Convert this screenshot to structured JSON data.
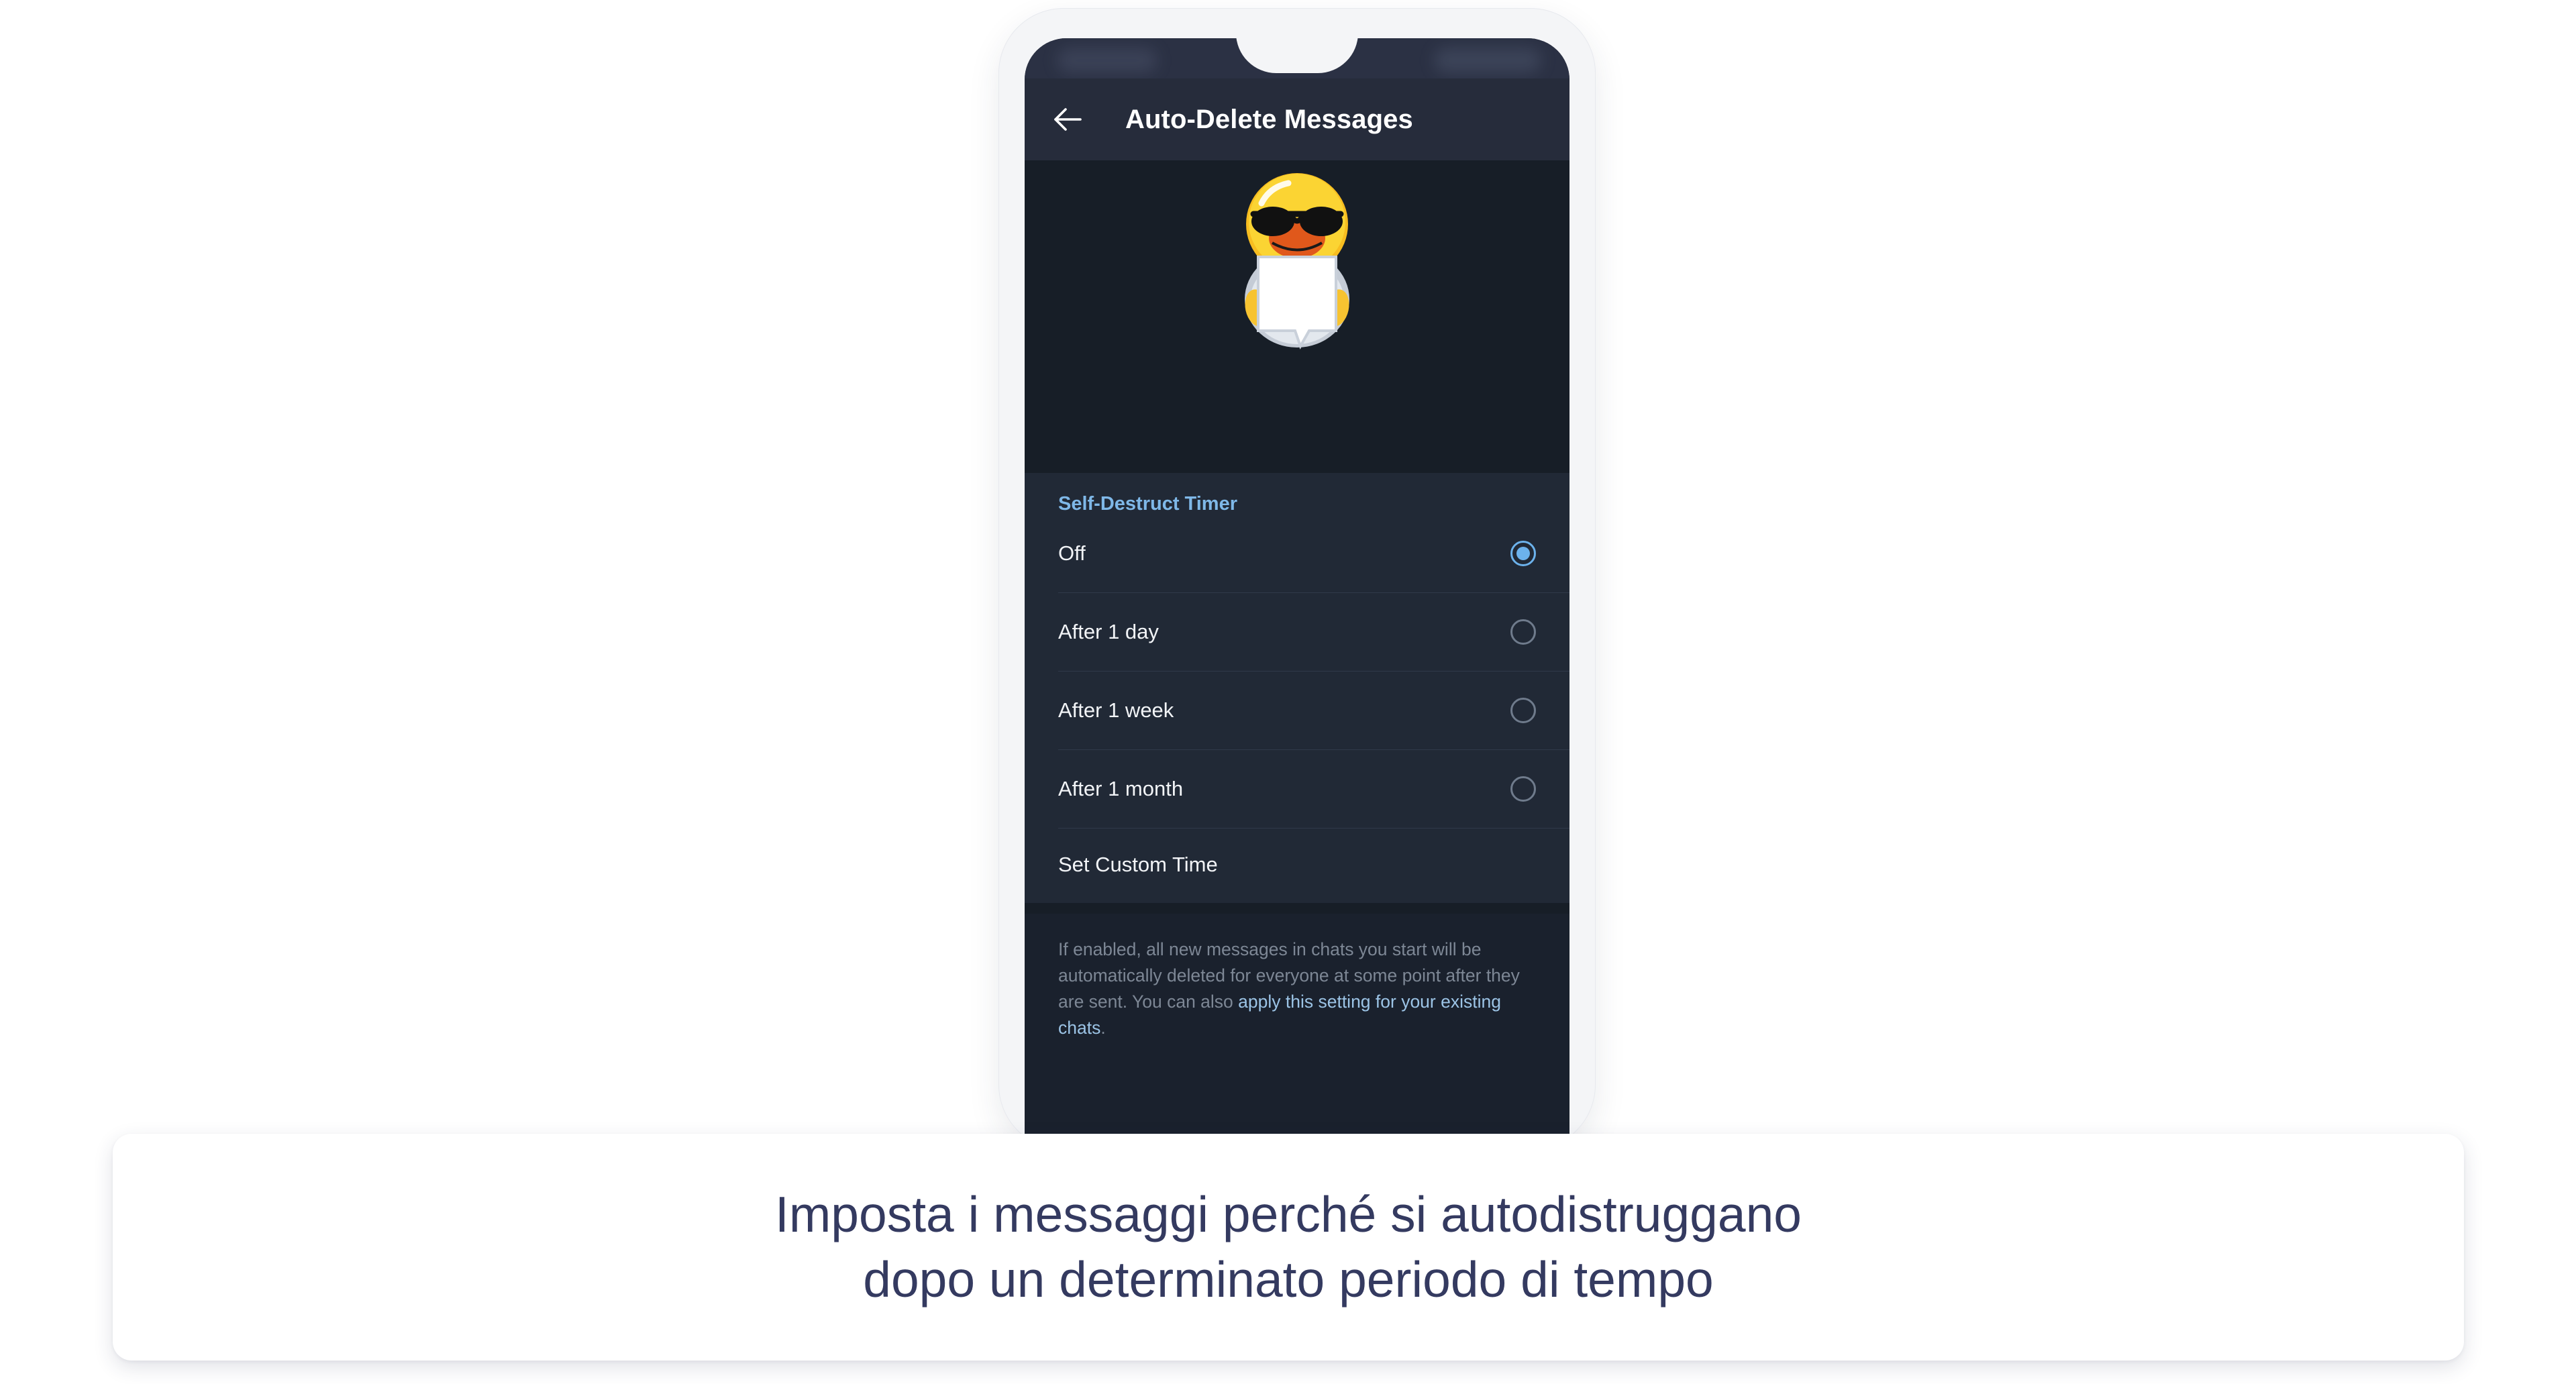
{
  "page": {
    "background_color": "#ffffff"
  },
  "phone": {
    "frame_color": "#f4f5f7",
    "screen_background": "#171e27",
    "status_bar": {
      "icon_left": "status-left-blurred",
      "icon_right": "status-right-blurred"
    }
  },
  "header": {
    "back_icon": "arrow-left-icon",
    "title": "Auto-Delete Messages",
    "background_color": "#262c3b",
    "title_color": "#ffffff"
  },
  "hero": {
    "avatar_icon": "duck-with-sunglasses-holding-blank-sign",
    "background_color": "#171e27"
  },
  "settings": {
    "section_title": "Self-Destruct Timer",
    "section_title_color": "#7fb8e8",
    "background_color": "#212936",
    "accent_color": "#6cb2ec",
    "options": [
      {
        "label": "Off",
        "selected": true
      },
      {
        "label": "After 1 day",
        "selected": false
      },
      {
        "label": "After 1 week",
        "selected": false
      },
      {
        "label": "After 1 month",
        "selected": false
      }
    ],
    "custom_time_label": "Set Custom Time"
  },
  "footer": {
    "text_before_link": "If enabled, all new messages in chats you start will be automatically deleted for everyone at some point after they are sent. You can also ",
    "link_text": "apply this setting for your existing chats",
    "text_after_link": ".",
    "text_color": "#7d8795",
    "link_color": "#9cc4e6",
    "background_color": "#1a212d"
  },
  "caption": {
    "line1": "Imposta i messaggi perché si autodistruggano",
    "line2": "dopo un determinato periodo di tempo",
    "text_color": "#343a60",
    "card_background": "#ffffff"
  }
}
